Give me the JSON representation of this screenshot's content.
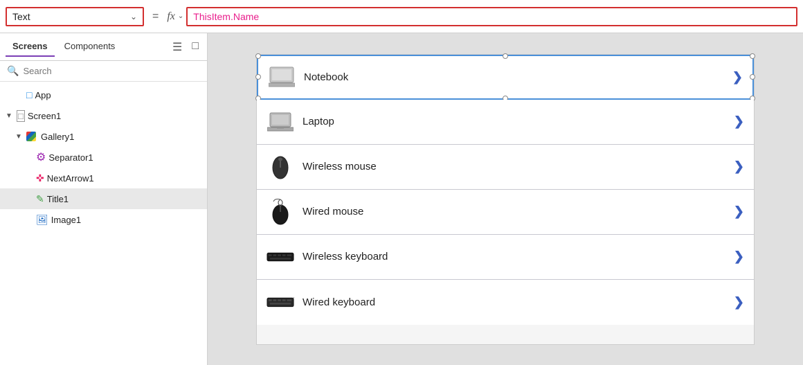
{
  "topbar": {
    "property_label": "Text",
    "equals": "=",
    "fx_label": "fx",
    "formula_value": "ThisItem.Name",
    "dropdown_arrow": "∨"
  },
  "left_panel": {
    "tab_screens": "Screens",
    "tab_components": "Components",
    "search_placeholder": "Search",
    "tree": [
      {
        "id": "app",
        "label": "App",
        "indent": 0,
        "icon": "app",
        "toggle": ""
      },
      {
        "id": "screen1",
        "label": "Screen1",
        "indent": 0,
        "icon": "screen",
        "toggle": "▼"
      },
      {
        "id": "gallery1",
        "label": "Gallery1",
        "indent": 1,
        "icon": "gallery",
        "toggle": "▼"
      },
      {
        "id": "separator1",
        "label": "Separator1",
        "indent": 2,
        "icon": "separator",
        "toggle": ""
      },
      {
        "id": "nextarrow1",
        "label": "NextArrow1",
        "indent": 2,
        "icon": "nextarrow",
        "toggle": ""
      },
      {
        "id": "title1",
        "label": "Title1",
        "indent": 2,
        "icon": "title",
        "toggle": ""
      },
      {
        "id": "image1",
        "label": "Image1",
        "indent": 2,
        "icon": "image",
        "toggle": ""
      }
    ]
  },
  "gallery": {
    "items": [
      {
        "id": "notebook",
        "label": "Notebook",
        "icon": "notebook",
        "selected": true
      },
      {
        "id": "laptop",
        "label": "Laptop",
        "icon": "laptop",
        "selected": false
      },
      {
        "id": "wireless-mouse",
        "label": "Wireless mouse",
        "icon": "mouse-wireless",
        "selected": false
      },
      {
        "id": "wired-mouse",
        "label": "Wired mouse",
        "icon": "mouse-wired",
        "selected": false
      },
      {
        "id": "wireless-keyboard",
        "label": "Wireless keyboard",
        "icon": "keyboard-wireless",
        "selected": false
      },
      {
        "id": "wired-keyboard",
        "label": "Wired keyboard",
        "icon": "keyboard-wired",
        "selected": false
      }
    ],
    "arrow_char": "❯"
  }
}
